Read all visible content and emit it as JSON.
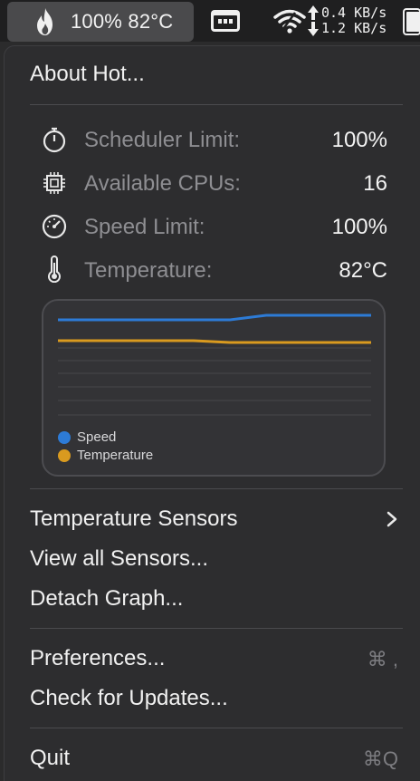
{
  "menubar": {
    "status_text": "100% 82°C",
    "net_up": "0.4 KB/s",
    "net_down": "1.2 KB/s",
    "icons": [
      "flame-icon",
      "app-window-icon",
      "wifi-icon",
      "up-down-arrows-icon",
      "battery-icon"
    ]
  },
  "menu": {
    "about": "About Hot...",
    "stats": [
      {
        "icon": "stopwatch-icon",
        "label": "Scheduler Limit:",
        "value": "100%"
      },
      {
        "icon": "cpu-chip-icon",
        "label": "Available CPUs:",
        "value": "16"
      },
      {
        "icon": "speedometer-icon",
        "label": "Speed Limit:",
        "value": "100%"
      },
      {
        "icon": "thermometer-icon",
        "label": "Temperature:",
        "value": "82°C"
      }
    ],
    "graph": {
      "legend": [
        {
          "name": "Speed",
          "color": "#2d7bd6"
        },
        {
          "name": "Temperature",
          "color": "#d99a1f"
        }
      ]
    },
    "temperature_sensors": "Temperature Sensors",
    "view_all_sensors": "View all Sensors...",
    "detach_graph": "Detach Graph...",
    "preferences": "Preferences...",
    "preferences_shortcut": "⌘ ,",
    "check_updates": "Check for Updates...",
    "quit": "Quit",
    "quit_shortcut": "⌘Q"
  }
}
